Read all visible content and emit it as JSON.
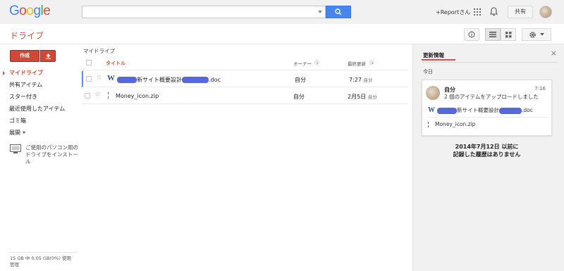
{
  "header": {
    "logo_letters": [
      "G",
      "o",
      "o",
      "g",
      "l",
      "e"
    ],
    "user_name": "+Reportさん",
    "share_label": "共有"
  },
  "app": {
    "title": "ドライブ"
  },
  "sidebar": {
    "create_label": "作成",
    "items": [
      {
        "label": "マイドライブ",
        "active": true
      },
      {
        "label": "共有アイテム"
      },
      {
        "label": "スター付き"
      },
      {
        "label": "最近使用したアイテム"
      },
      {
        "label": "ゴミ箱"
      },
      {
        "label": "展開"
      }
    ],
    "install_text": "ご使用のパソコン用のドライブをインストール",
    "storage_text": "15 GB 中 0.05 GB(0%) 使用",
    "manage_label": "管理"
  },
  "main": {
    "breadcrumb": "マイドライブ",
    "columns": {
      "title": "タイトル",
      "owner": "オーナー",
      "modified": "最終更新"
    },
    "files": [
      {
        "icon": "word-icon",
        "name_prefix": "",
        "name_mid": "新サイト概要設計",
        "name_suffix": ".doc",
        "owner": "自分",
        "time": "7:27",
        "time_suffix": "自分"
      },
      {
        "icon": "zip-icon",
        "name": "Money_icon.zip",
        "owner": "自分",
        "time": "2月5日",
        "time_suffix": "自分"
      }
    ]
  },
  "activity": {
    "title": "更新情報",
    "today_label": "今日",
    "entry": {
      "user": "自分",
      "time": "7:16",
      "action": "2 個のアイテムをアップロードしました",
      "file1_mid": "新サイト概要設計",
      "file1_suffix": ".doc",
      "file2": "Money_icon.zip"
    },
    "no_history_line1": "2014年7月12日 以前に",
    "no_history_line2": "記録した履歴はありません"
  },
  "colors": {
    "accent_red": "#dd4b39",
    "search_blue": "#4787ed",
    "word_blue": "#2a5699"
  }
}
